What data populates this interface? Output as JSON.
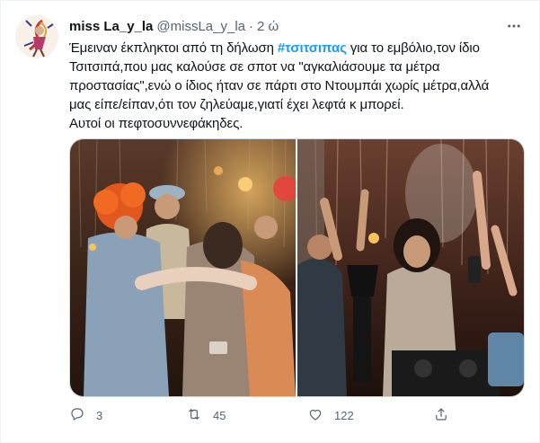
{
  "user": {
    "display_name": "miss La_y_la",
    "handle": "@missLa_y_la",
    "separator": "·",
    "time": "2 ώ"
  },
  "tweet": {
    "line1_pre": "Έμειναν έκπληκτοι από τη δήλωση ",
    "hashtag": "#τσιτσιπας",
    "line1_post": " για το εμβόλιο,τον ίδιο",
    "line2": "Τσιτσιπά,που μας καλούσε σε σποτ να \"αγκαλιάσουμε τα μέτρα",
    "line3": "προστασίας\",ενώ ο ίδιος ήταν σε πάρτι στο Ντουμπάι χωρίς μέτρα,αλλά",
    "line4": "μας είπε/είπαν,ότι τον ζηλεύαμε,γιατί έχει λεφτά κ μπορεί.",
    "line5": "Αυτοί οι πεφτοσυννεφάκηδες."
  },
  "actions": {
    "replies": "3",
    "retweets": "45",
    "likes": "122"
  },
  "colors": {
    "link": "#1d9bf0",
    "secondary_text": "#536471",
    "border": "#cfd9de"
  },
  "icons": {
    "more": "more-dots-icon",
    "reply": "reply-icon",
    "retweet": "retweet-icon",
    "like": "heart-icon",
    "share": "share-icon"
  }
}
